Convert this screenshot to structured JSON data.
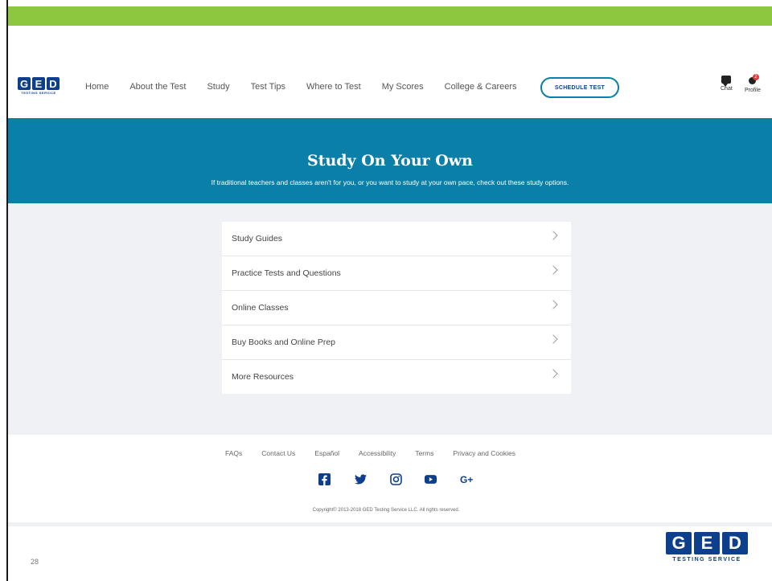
{
  "brand": {
    "letters": [
      "G",
      "E",
      "D"
    ],
    "tagline": "TESTING SERVICE",
    "green": "#8dc63f",
    "blue": "#0a7fa8",
    "navy": "#0d3f8c"
  },
  "nav": {
    "links": [
      "Home",
      "About the Test",
      "Study",
      "Test Tips",
      "Where to Test",
      "My Scores",
      "College & Careers"
    ],
    "schedule_label": "SCHEDULE TEST",
    "chat_label": "Chat",
    "profile_label": "Profile",
    "profile_badge": "2"
  },
  "hero": {
    "title": "Study On Your Own",
    "subtitle": "If traditional teachers and classes aren't for you, or you want to study at your own pace, check out these study options."
  },
  "menu": {
    "items": [
      "Study Guides",
      "Practice Tests and Questions",
      "Online Classes",
      "Buy Books and Online Prep",
      "More Resources"
    ]
  },
  "footer": {
    "links": [
      "FAQs",
      "Contact Us",
      "Español",
      "Accessibility",
      "Terms",
      "Privacy and Cookies"
    ],
    "social": [
      "facebook-icon",
      "twitter-icon",
      "instagram-icon",
      "youtube-icon",
      "google-plus-icon"
    ],
    "copyright": "Copyright© 2013-2018 GED Testing Service LLC. All rights reserved."
  },
  "slide": {
    "page_number": "28"
  }
}
